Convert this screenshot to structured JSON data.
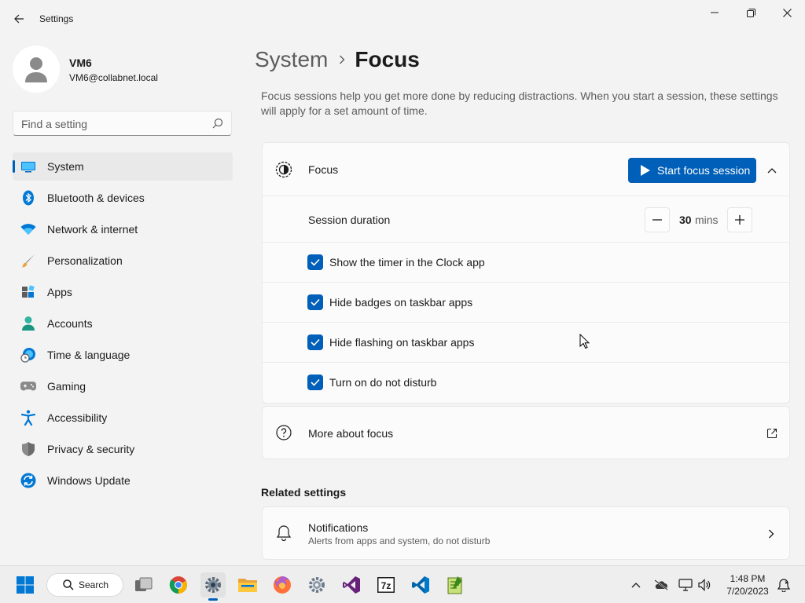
{
  "window": {
    "title": "Settings"
  },
  "user": {
    "name": "VM6",
    "email": "VM6@collabnet.local"
  },
  "search": {
    "placeholder": "Find a setting"
  },
  "sidebar": {
    "items": [
      {
        "label": "System",
        "icon": "system-icon",
        "selected": true
      },
      {
        "label": "Bluetooth & devices",
        "icon": "bluetooth-icon"
      },
      {
        "label": "Network & internet",
        "icon": "wifi-icon"
      },
      {
        "label": "Personalization",
        "icon": "brush-icon"
      },
      {
        "label": "Apps",
        "icon": "apps-icon"
      },
      {
        "label": "Accounts",
        "icon": "accounts-icon"
      },
      {
        "label": "Time & language",
        "icon": "globe-clock-icon"
      },
      {
        "label": "Gaming",
        "icon": "gamepad-icon"
      },
      {
        "label": "Accessibility",
        "icon": "accessibility-icon"
      },
      {
        "label": "Privacy & security",
        "icon": "shield-icon"
      },
      {
        "label": "Windows Update",
        "icon": "windows-update-icon"
      }
    ]
  },
  "breadcrumb": {
    "parent": "System",
    "current": "Focus"
  },
  "page": {
    "description": "Focus sessions help you get more done by reducing distractions. When you start a session, these settings will apply for a set amount of time."
  },
  "focus": {
    "title": "Focus",
    "start_button": "Start focus session",
    "session_duration_label": "Session duration",
    "duration_value": "30",
    "duration_unit": "mins",
    "options": [
      {
        "label": "Show the timer in the Clock app",
        "checked": true
      },
      {
        "label": "Hide badges on taskbar apps",
        "checked": true
      },
      {
        "label": "Hide flashing on taskbar apps",
        "checked": true
      },
      {
        "label": "Turn on do not disturb",
        "checked": true
      }
    ]
  },
  "more_about": {
    "label": "More about focus"
  },
  "related": {
    "heading": "Related settings",
    "notifications_title": "Notifications",
    "notifications_subtitle": "Alerts from apps and system, do not disturb"
  },
  "taskbar": {
    "search_label": "Search",
    "time": "1:48 PM",
    "date": "7/20/2023",
    "apps": [
      "start-icon",
      "task-view-icon",
      "chrome-icon",
      "settings-icon",
      "file-explorer-icon",
      "firefox-icon",
      "control-panel-icon",
      "visual-studio-icon",
      "7zip-icon",
      "vscode-icon",
      "notepad-plus-plus-icon"
    ]
  },
  "colors": {
    "accent": "#005fb8",
    "background": "#f3f3f3",
    "card": "#fbfbfb"
  }
}
